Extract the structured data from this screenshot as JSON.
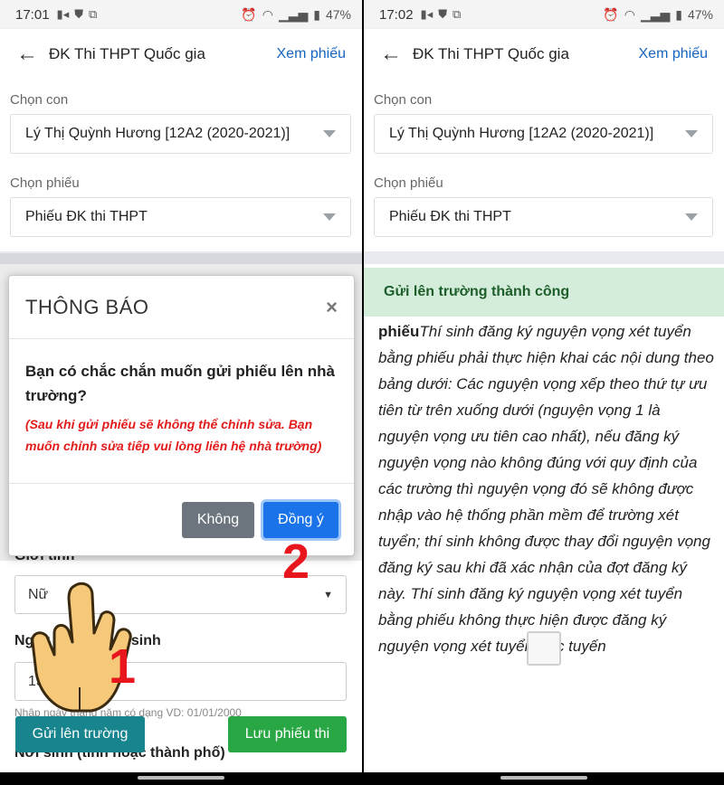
{
  "status_left": {
    "time": "17:01",
    "battery": "47%"
  },
  "status_right": {
    "time": "17:02",
    "battery": "47%"
  },
  "appbar": {
    "title": "ĐK Thi THPT Quốc gia",
    "action": "Xem phiếu"
  },
  "form": {
    "child_label": "Chọn con",
    "child_value": "Lý Thị Quỳnh Hương [12A2 (2020-2021)]",
    "ballot_label": "Chọn phiếu",
    "ballot_value": "Phiếu ĐK thi THPT",
    "gender_label": "Giới tính",
    "gender_value": "Nữ",
    "dob_label": "Ngày tháng năm sinh",
    "dob_value": "15/06/2003",
    "dob_hint": "Nhập ngày tháng năm có dạng VD: 01/01/2000",
    "birthplace_label": "Nơi sinh (tỉnh hoặc thành phố)"
  },
  "buttons": {
    "submit": "Gửi lên trường",
    "save": "Lưu phiếu thi"
  },
  "modal": {
    "title": "THÔNG BÁO",
    "close": "×",
    "question": "Bạn có chắc chắn muốn gửi phiếu lên nhà trường?",
    "warning": "(Sau khi gửi phiếu sẽ không thể chỉnh sửa. Bạn muốn chỉnh sửa tiếp vui lòng liên hệ nhà trường)",
    "cancel": "Không",
    "confirm": "Đồng ý"
  },
  "steps": {
    "one": "1",
    "two": "2"
  },
  "right_screen": {
    "toast": "Gửi lên trường thành công",
    "para_lead": "phiếu",
    "para_text": "Thí sinh đăng ký nguyện vọng xét tuyển bằng phiếu phải thực hiện khai các nội dung theo bảng dưới: Các nguyện vọng xếp theo thứ tự ưu tiên từ trên xuống dưới (nguyện vọng 1 là nguyện vọng ưu tiên cao nhất), nếu đăng ký nguyện vọng nào không đúng với quy định của các trường thì nguyện vọng đó sẽ không được nhập vào hệ thống phần mềm để trường xét tuyển; thí sinh không được thay đổi nguyện vọng đăng ký sau khi đã xác nhận của đợt đăng ký này. Thí sinh đăng ký nguyện vọng xét tuyển bằng phiếu không thực hiện được đăng ký nguyện vọng xét tuyển trực tuyến"
  },
  "colors": {
    "accent": "#1565c0",
    "teal": "#17848e",
    "green": "#29a745",
    "red": "#e8161c",
    "toast_bg": "#d4edda"
  }
}
